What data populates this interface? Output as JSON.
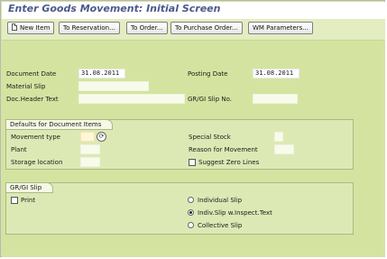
{
  "title": "Enter Goods Movement: Initial Screen",
  "toolbar": {
    "new_item": "New Item",
    "to_reservation": "To Reservation...",
    "to_order": "To Order...",
    "to_purchase_order": "To Purchase Order...",
    "wm_parameters": "WM Parameters..."
  },
  "header": {
    "document_date_label": "Document Date",
    "document_date_value": "31.08.2011",
    "posting_date_label": "Posting Date",
    "posting_date_value": "31.08.2011",
    "material_slip_label": "Material Slip",
    "material_slip_value": "",
    "doc_header_text_label": "Doc.Header Text",
    "doc_header_text_value": "",
    "gr_gi_slip_no_label": "GR/GI Slip No.",
    "gr_gi_slip_no_value": ""
  },
  "defaults": {
    "tab": "Defaults for Document Items",
    "movement_type_label": "Movement type",
    "movement_type_value": "",
    "plant_label": "Plant",
    "plant_value": "",
    "storage_location_label": "Storage location",
    "storage_location_value": "",
    "special_stock_label": "Special Stock",
    "special_stock_value": "",
    "reason_label": "Reason for Movement",
    "reason_value": "",
    "suggest_zero_lines_label": "Suggest Zero Lines",
    "suggest_zero_lines_checked": false
  },
  "slip": {
    "tab": "GR/GI Slip",
    "print_label": "Print",
    "print_checked": false,
    "options": [
      "Individual Slip",
      "Indiv.Slip w.Inspect.Text",
      "Collective Slip"
    ],
    "selected_option": "Indiv.Slip w.Inspect.Text"
  },
  "colors": {
    "background": "#d4e4a0",
    "title": "#4a5a8a"
  }
}
